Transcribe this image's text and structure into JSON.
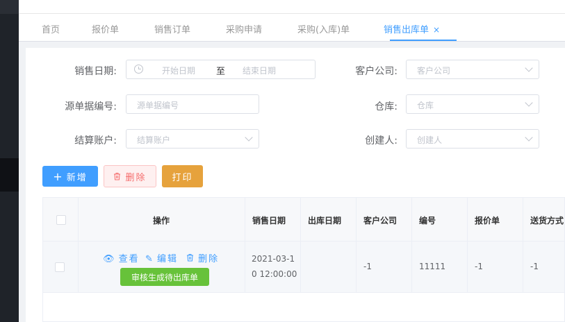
{
  "tabs": [
    {
      "label": "首页"
    },
    {
      "label": "报价单"
    },
    {
      "label": "销售订单"
    },
    {
      "label": "采购申请"
    },
    {
      "label": "采购(入库)单"
    },
    {
      "label": "销售出库单",
      "close": "×"
    }
  ],
  "filters": {
    "sale_date": {
      "label": "销售日期:",
      "start_placeholder": "开始日期",
      "separator": "至",
      "end_placeholder": "结束日期"
    },
    "customer": {
      "label": "客户公司:",
      "placeholder": "客户公司"
    },
    "source_no": {
      "label": "源单据编号:",
      "placeholder": "源单据编号"
    },
    "warehouse": {
      "label": "仓库:",
      "placeholder": "仓库"
    },
    "account": {
      "label": "结算账户:",
      "placeholder": "结算账户"
    },
    "creator": {
      "label": "创建人:",
      "placeholder": "创建人"
    }
  },
  "toolbar": {
    "add_icon": "+",
    "add_label": "新增",
    "delete_label": "删除",
    "print_label": "打印"
  },
  "table": {
    "columns": [
      "操作",
      "销售日期",
      "出库日期",
      "客户公司",
      "编号",
      "报价单",
      "送货方式"
    ],
    "row": {
      "actions": {
        "view": "查看",
        "edit": "编辑",
        "delete": "删除",
        "audit": "审核生成待出库单"
      },
      "sale_date_line1": "2021-03-1",
      "sale_date_line2": "0 12:00:00",
      "out_date": "",
      "customer": "-1",
      "number": "11111",
      "quote": "-1",
      "delivery": "-1"
    }
  },
  "colors": {
    "primary": "#409eff",
    "danger": "#f56c6c",
    "warning": "#e6a23c",
    "success": "#67c23a"
  }
}
